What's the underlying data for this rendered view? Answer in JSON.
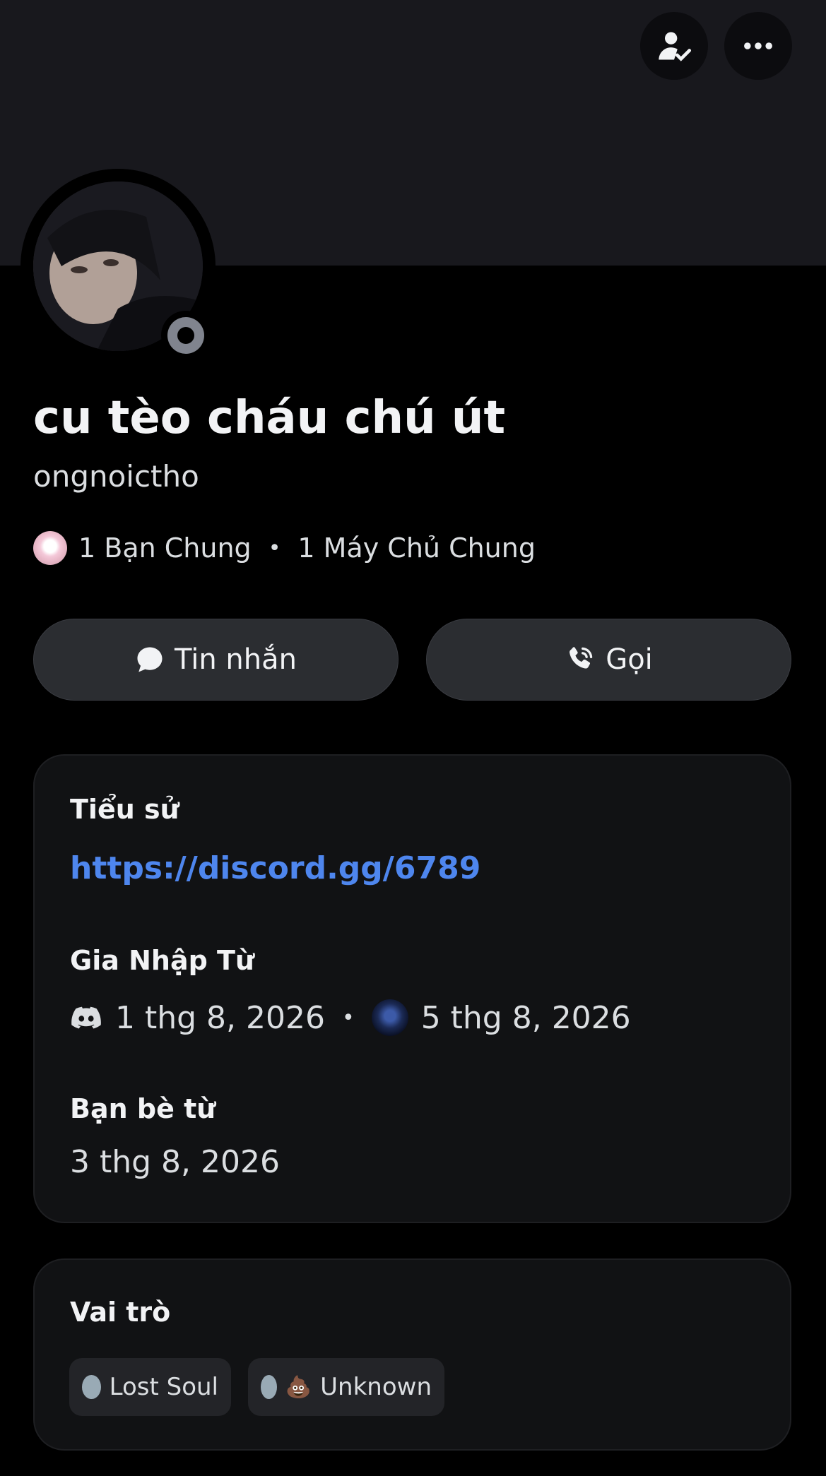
{
  "header": {
    "friend_icon": "friend-check-icon",
    "more_icon": "more-horizontal-icon"
  },
  "profile": {
    "display_name": "cu tèo cháu chú út",
    "username": "ongnoictho",
    "status": "offline"
  },
  "mutuals": {
    "friends": "1 Bạn Chung",
    "separator": "•",
    "servers": "1 Máy Chủ Chung"
  },
  "actions": {
    "message_label": "Tin nhắn",
    "call_label": "Gọi"
  },
  "about": {
    "bio_title": "Tiểu sử",
    "bio_link": "https://discord.gg/6789",
    "joined_title": "Gia Nhập Từ",
    "discord_joined": "1 thg 8, 2026",
    "separator": "•",
    "server_joined": "5 thg 8, 2026",
    "friends_since_title": "Bạn bè từ",
    "friends_since": "3 thg 8, 2026"
  },
  "roles": {
    "title": "Vai trò",
    "items": [
      {
        "label": "Lost Soul",
        "color": "#99aab5"
      },
      {
        "label": "Unknown",
        "color": "#99aab5",
        "emoji": "💩"
      }
    ]
  },
  "colors": {
    "background": "#000000",
    "card": "#111214",
    "link": "#4e86ee",
    "button": "#2b2d31"
  }
}
